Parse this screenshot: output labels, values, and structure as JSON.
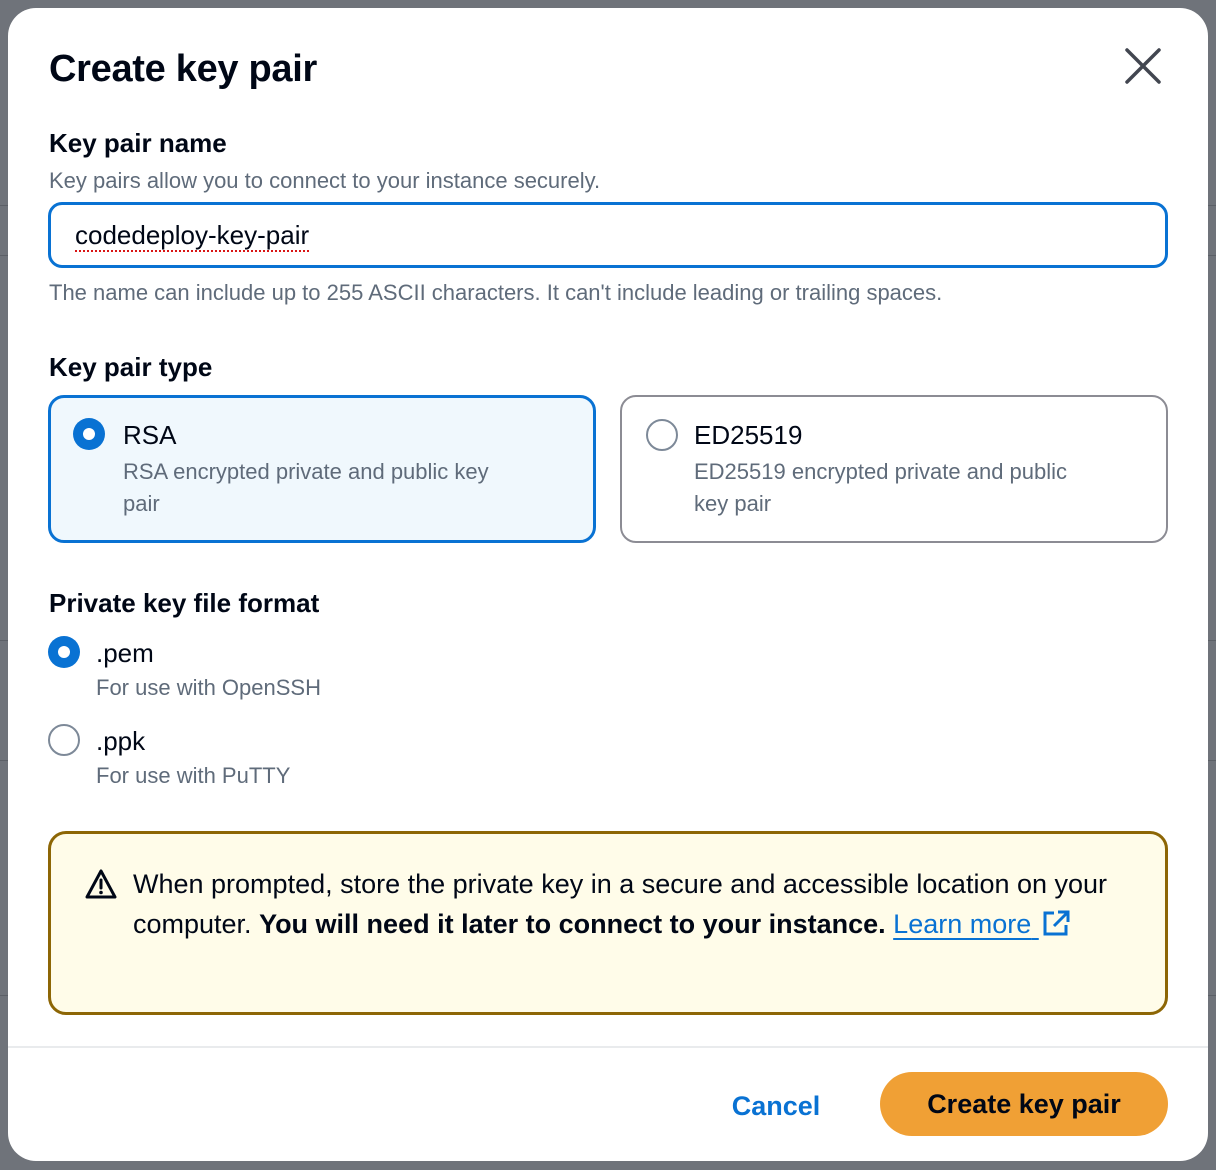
{
  "modal": {
    "title": "Create key pair",
    "close_icon": "close-icon"
  },
  "key_name": {
    "label": "Key pair name",
    "description": "Key pairs allow you to connect to your instance securely.",
    "value": "codedeploy-key-pair",
    "constraint": "The name can include up to 255 ASCII characters. It can't include leading or trailing spaces."
  },
  "key_type": {
    "label": "Key pair type",
    "options": [
      {
        "title": "RSA",
        "desc_line1": "RSA encrypted private and public key",
        "desc_line2": "pair",
        "selected": true
      },
      {
        "title": "ED25519",
        "desc_line1": "ED25519 encrypted private and public",
        "desc_line2": "key pair",
        "selected": false
      }
    ]
  },
  "file_format": {
    "label": "Private key file format",
    "options": [
      {
        "title": ".pem",
        "desc": "For use with OpenSSH",
        "selected": true
      },
      {
        "title": ".ppk",
        "desc": "For use with PuTTY",
        "selected": false
      }
    ]
  },
  "alert": {
    "icon": "warning-icon",
    "text_part1": "When prompted, store the private key in a secure and accessible location on your computer. ",
    "text_bold": "You will need it later to connect to your instance.",
    "link_text": "Learn more",
    "link_icon": "external-link-icon"
  },
  "footer": {
    "cancel_label": "Cancel",
    "create_label": "Create key pair"
  },
  "colors": {
    "primary": "#0972d3",
    "create_button": "#f0a035",
    "alert_border": "#8d6605",
    "alert_background": "#fffce9"
  }
}
